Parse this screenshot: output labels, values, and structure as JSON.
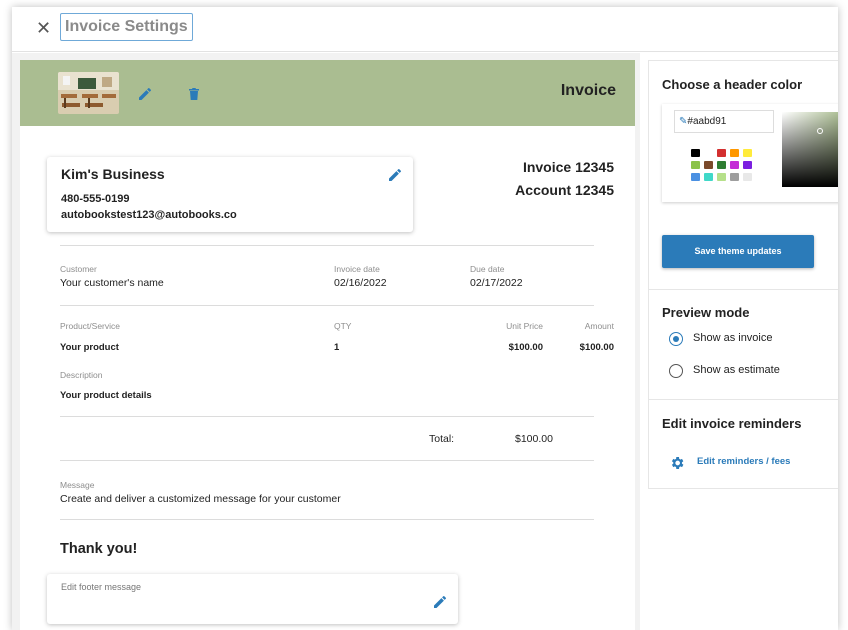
{
  "window": {
    "close_icon": "close-icon",
    "title": "Invoice Settings"
  },
  "colors": {
    "header_bg": "#aabd91",
    "accent": "#2b7bb9"
  },
  "invoice": {
    "header_title": "Invoice",
    "logo_icon": "classroom-image",
    "business": {
      "name": "Kim's Business",
      "phone": "480-555-0199",
      "email": "autobookstest123@autobooks.co"
    },
    "invoice_number": "Invoice 12345",
    "account_number": "Account 12345",
    "customer_label": "Customer",
    "customer_value": "Your customer's name",
    "invoice_date_label": "Invoice date",
    "invoice_date_value": "02/16/2022",
    "due_date_label": "Due date",
    "due_date_value": "02/17/2022",
    "columns": [
      "Product/Service",
      "QTY",
      "Unit Price",
      "Amount"
    ],
    "item": {
      "product": "Your product",
      "qty": "1",
      "unit_price": "$100.00",
      "amount": "$100.00"
    },
    "description_label": "Description",
    "description_value": "Your product details",
    "total_label": "Total:",
    "total_value": "$100.00",
    "message_label": "Message",
    "message_value": "Create and deliver a customized message for your customer",
    "thanks": "Thank you!",
    "footer_placeholder": "Edit footer message"
  },
  "side": {
    "color_heading": "Choose a header color",
    "hex_value": "#aabd91",
    "swatches": [
      "#000000",
      "#ffffff",
      "#d32f2f",
      "#ff9800",
      "#ffeb3b",
      "#8bc34a",
      "#7b4a2b",
      "#2e7d32",
      "#c42bd6",
      "#7b1fe0",
      "#4a90e2",
      "#40d8c8",
      "#b6e08a",
      "#9e9e9e",
      "#e8e8e8"
    ],
    "save_label": "Save theme updates",
    "preview_heading": "Preview mode",
    "preview_options": [
      "Show as invoice",
      "Show as estimate"
    ],
    "preview_selected": "Show as invoice",
    "reminders_heading": "Edit invoice reminders",
    "reminders_link": "Edit reminders / fees"
  }
}
